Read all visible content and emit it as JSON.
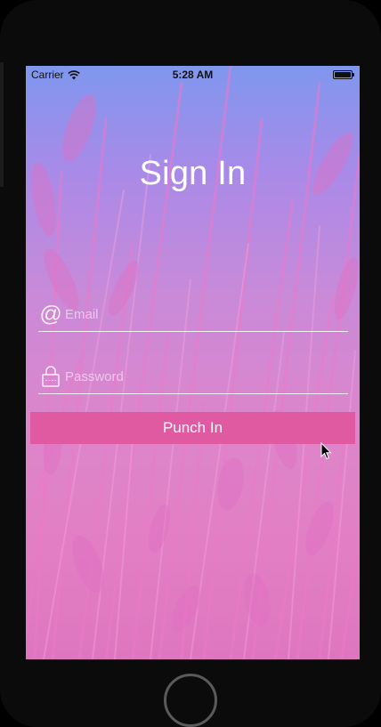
{
  "status_bar": {
    "carrier": "Carrier",
    "time": "5:28 AM",
    "wifi_icon": "wifi-icon",
    "battery_icon": "battery-icon"
  },
  "page": {
    "title": "Sign In"
  },
  "form": {
    "email": {
      "icon": "at-sign-icon",
      "value": "",
      "placeholder": "Email"
    },
    "password": {
      "icon": "lock-icon",
      "value": "",
      "placeholder": "Password"
    },
    "submit_label": "Punch In"
  },
  "colors": {
    "button": "#e05aa2",
    "gradient_top": "#7f97ee",
    "gradient_bottom": "#de76bf"
  }
}
